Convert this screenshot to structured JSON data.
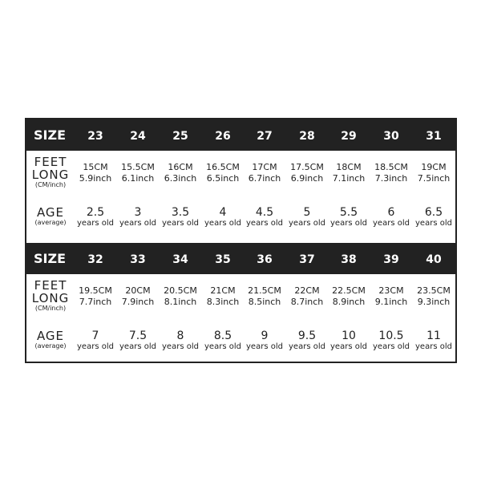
{
  "labels": {
    "size": "SIZE",
    "feet1": "FEET",
    "feet2": "LONG",
    "feet_unit": "(CM/inch)",
    "age": "AGE",
    "age_sub": "(average)"
  },
  "blocks": [
    {
      "sizes": [
        "23",
        "24",
        "25",
        "26",
        "27",
        "28",
        "29",
        "30",
        "31"
      ],
      "cm": [
        "15CM",
        "15.5CM",
        "16CM",
        "16.5CM",
        "17CM",
        "17.5CM",
        "18CM",
        "18.5CM",
        "19CM"
      ],
      "inch": [
        "5.9inch",
        "6.1inch",
        "6.3inch",
        "6.5inch",
        "6.7inch",
        "6.9inch",
        "7.1inch",
        "7.3inch",
        "7.5inch"
      ],
      "age": [
        "2.5",
        "3",
        "3.5",
        "4",
        "4.5",
        "5",
        "5.5",
        "6",
        "6.5"
      ]
    },
    {
      "sizes": [
        "32",
        "33",
        "34",
        "35",
        "36",
        "37",
        "38",
        "39",
        "40"
      ],
      "cm": [
        "19.5CM",
        "20CM",
        "20.5CM",
        "21CM",
        "21.5CM",
        "22CM",
        "22.5CM",
        "23CM",
        "23.5CM"
      ],
      "inch": [
        "7.7inch",
        "7.9inch",
        "8.1inch",
        "8.3inch",
        "8.5inch",
        "8.7inch",
        "8.9inch",
        "9.1inch",
        "9.3inch"
      ],
      "age": [
        "7",
        "7.5",
        "8",
        "8.5",
        "9",
        "9.5",
        "10",
        "10.5",
        "11"
      ]
    }
  ],
  "years_old": "years old",
  "colors": {
    "header_bg": "#222222",
    "header_text": "#ffffff",
    "text": "#222222"
  }
}
